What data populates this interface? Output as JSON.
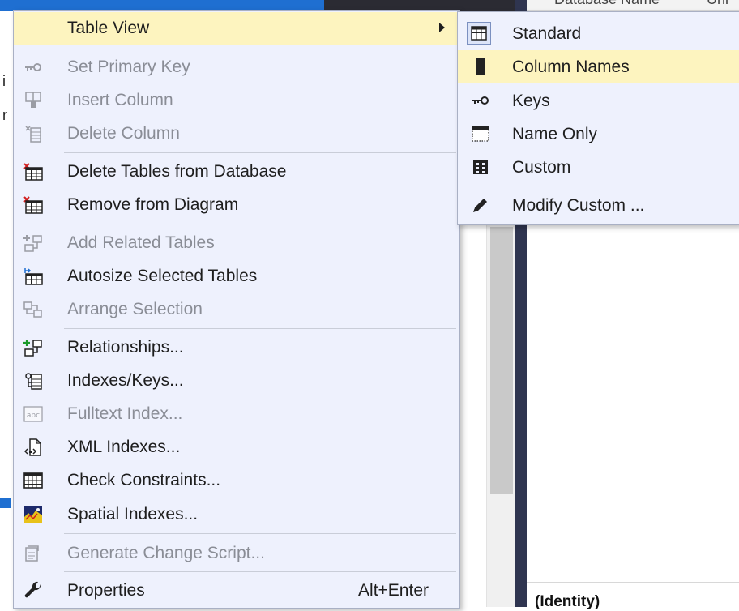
{
  "background": {
    "left_chars": [
      "i",
      "r"
    ],
    "grid_header": [
      "Database Name",
      "Uni"
    ],
    "properties_label": "(Identity)"
  },
  "menu": {
    "items": [
      {
        "label": "Table View",
        "icon": "none",
        "enabled": true,
        "submenu": true,
        "highlighted": true
      },
      {
        "label": "Set Primary Key",
        "icon": "key-icon",
        "enabled": false
      },
      {
        "label": "Insert Column",
        "icon": "insert-column-icon",
        "enabled": false
      },
      {
        "label": "Delete Column",
        "icon": "delete-column-icon",
        "enabled": false
      },
      {
        "label": "Delete Tables from Database",
        "icon": "delete-table-icon",
        "enabled": true
      },
      {
        "label": "Remove from Diagram",
        "icon": "remove-table-icon",
        "enabled": true
      },
      {
        "label": "Add Related Tables",
        "icon": "add-related-tables-icon",
        "enabled": false
      },
      {
        "label": "Autosize Selected Tables",
        "icon": "autosize-table-icon",
        "enabled": true
      },
      {
        "label": "Arrange Selection",
        "icon": "arrange-icon",
        "enabled": false
      },
      {
        "label": "Relationships...",
        "icon": "relationships-icon",
        "enabled": true
      },
      {
        "label": "Indexes/Keys...",
        "icon": "indexes-keys-icon",
        "enabled": true
      },
      {
        "label": "Fulltext Index...",
        "icon": "fulltext-index-icon",
        "enabled": false
      },
      {
        "label": "XML Indexes...",
        "icon": "xml-index-icon",
        "enabled": true
      },
      {
        "label": "Check Constraints...",
        "icon": "check-constraints-icon",
        "enabled": true
      },
      {
        "label": "Spatial Indexes...",
        "icon": "spatial-index-icon",
        "enabled": true
      },
      {
        "label": "Generate Change Script...",
        "icon": "change-script-icon",
        "enabled": false
      },
      {
        "label": "Properties",
        "icon": "wrench-icon",
        "enabled": true,
        "shortcut": "Alt+Enter"
      }
    ]
  },
  "submenu": {
    "items": [
      {
        "label": "Standard",
        "icon": "standard-view-icon",
        "checked": true
      },
      {
        "label": "Column Names",
        "icon": "column-names-icon",
        "highlighted": true
      },
      {
        "label": "Keys",
        "icon": "keys-icon"
      },
      {
        "label": "Name Only",
        "icon": "name-only-icon"
      },
      {
        "label": "Custom",
        "icon": "custom-view-icon"
      },
      {
        "label": "Modify Custom ...",
        "icon": "pencil-icon"
      }
    ]
  },
  "colors": {
    "menu_background": "#eef1fd",
    "highlight": "#fdf4bf",
    "disabled_text": "#8a8d96",
    "title_bar_blue": "#1f6fd1",
    "dark_panel": "#2f3550"
  }
}
